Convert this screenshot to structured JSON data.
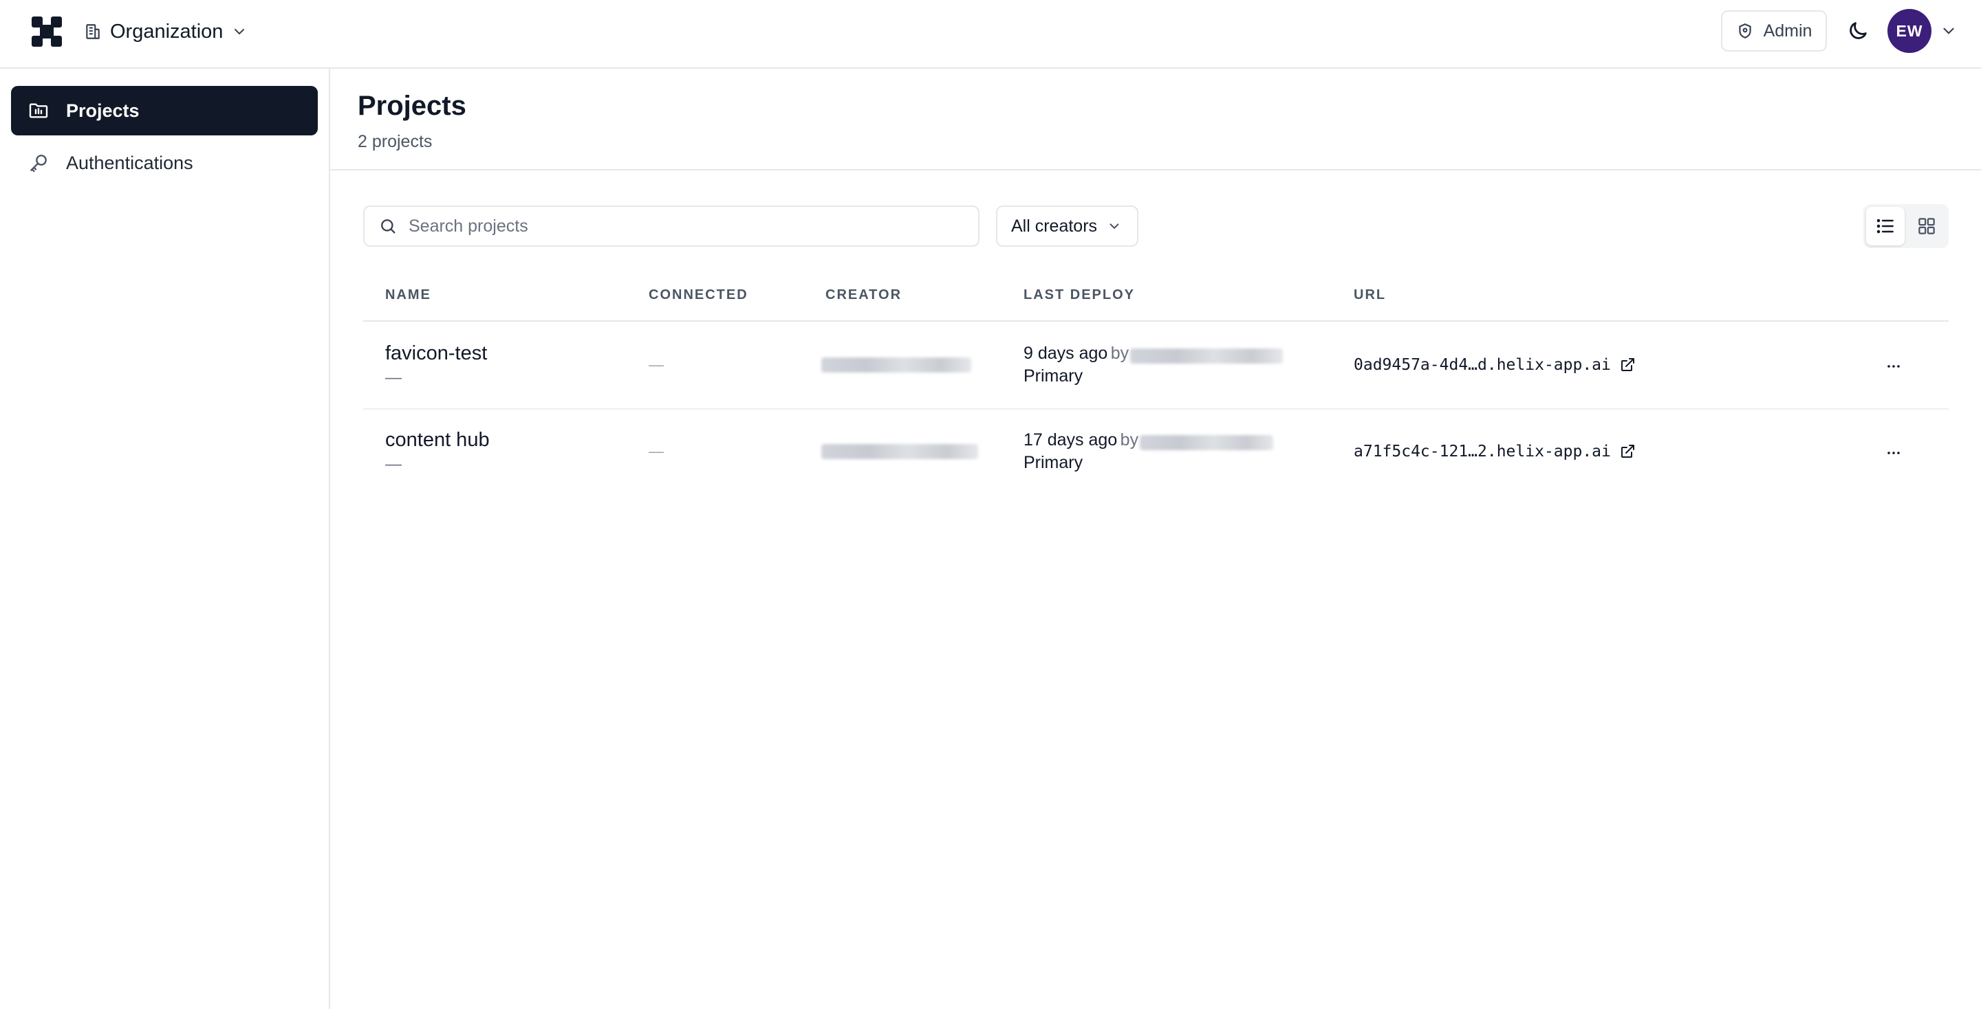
{
  "topbar": {
    "org_label": "Organization",
    "admin_label": "Admin",
    "avatar_initials": "EW",
    "avatar_color": "#3b1f7a"
  },
  "sidebar": {
    "items": [
      {
        "label": "Projects",
        "icon": "folder-icon",
        "active": true
      },
      {
        "label": "Authentications",
        "icon": "key-icon",
        "active": false
      }
    ]
  },
  "main": {
    "title": "Projects",
    "subtitle": "2 projects",
    "search_placeholder": "Search projects",
    "creators_filter": "All creators",
    "columns": [
      "NAME",
      "CONNECTED",
      "CREATOR",
      "LAST DEPLOY",
      "URL"
    ],
    "rows": [
      {
        "name": "favicon-test",
        "name_sub": "—",
        "connected": "—",
        "last_deploy": "9 days ago",
        "by_label": "by",
        "environment": "Primary",
        "url": "0ad9457a-4d4…d.helix-app.ai"
      },
      {
        "name": "content hub",
        "name_sub": "—",
        "connected": "—",
        "last_deploy": "17 days ago",
        "by_label": "by",
        "environment": "Primary",
        "url": "a71f5c4c-121…2.helix-app.ai"
      }
    ]
  }
}
